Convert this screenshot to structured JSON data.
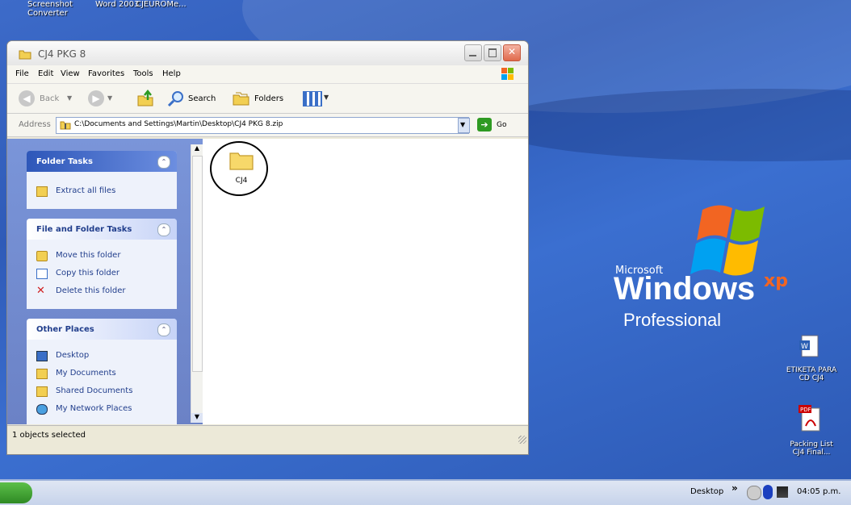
{
  "desktop": {
    "top_labels": [
      "Screenshot\nConverter",
      "Word 2003",
      "CJEUROMe..."
    ],
    "logo": {
      "brand": "Microsoft",
      "product": "Windows",
      "version": "xp",
      "edition": "Professional"
    },
    "icons": [
      {
        "label": "ETIKETA PARA\nCD CJ4",
        "icon": "word-document-icon"
      },
      {
        "label": "Packing List\nCJ4 Final...",
        "icon": "pdf-document-icon"
      }
    ]
  },
  "window": {
    "title": "CJ4 PKG 8",
    "menu": [
      "File",
      "Edit",
      "View",
      "Favorites",
      "Tools",
      "Help"
    ],
    "toolbar": {
      "back": "Back",
      "search": "Search",
      "folders": "Folders"
    },
    "address": {
      "label": "Address",
      "value": "C:\\Documents and Settings\\Martin\\Desktop\\CJ4 PKG 8.zip",
      "go": "Go"
    },
    "panels": {
      "folder_tasks": {
        "title": "Folder Tasks",
        "items": [
          "Extract all files"
        ]
      },
      "file_folder_tasks": {
        "title": "File and Folder Tasks",
        "items": [
          "Move this folder",
          "Copy this folder",
          "Delete this folder"
        ]
      },
      "other_places": {
        "title": "Other Places",
        "items": [
          "Desktop",
          "My Documents",
          "Shared Documents",
          "My Network Places"
        ]
      }
    },
    "files": [
      {
        "name": "CJ4",
        "type": "folder",
        "selected": true
      }
    ],
    "status": "1 objects selected"
  },
  "taskbar": {
    "desktop_label": "Desktop",
    "chevron": "»",
    "clock": "04:05 p.m."
  },
  "colors": {
    "desktop_blue": "#3b6fd0",
    "panel_blue": "#7a95d9",
    "start_green": "#3a9a2d",
    "xp_orange": "#f26522"
  }
}
